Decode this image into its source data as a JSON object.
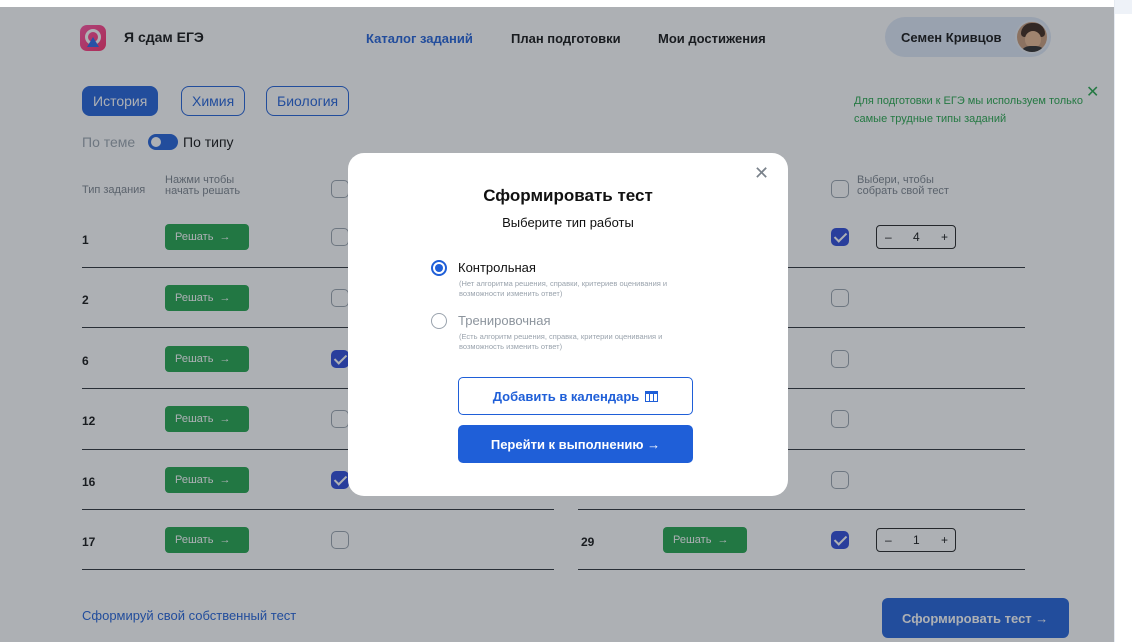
{
  "header": {
    "brand": "Я сдам ЕГЭ",
    "nav": [
      "Каталог заданий",
      "План подготовки",
      "Мои достижения"
    ],
    "user_name": "Семен Кривцов"
  },
  "subjects": [
    "История",
    "Химия",
    "Биология"
  ],
  "toggle": {
    "left": "По теме",
    "right": "По типу"
  },
  "table": {
    "col_type": "Тип задания",
    "col_solve": "Нажми чтобы начать решать",
    "col_select": "Выбери, чтобы собрать свой тест",
    "solve_label": "Решать",
    "arrow": "→",
    "left_rows": [
      {
        "num": "1",
        "checked": false
      },
      {
        "num": "2",
        "checked": false
      },
      {
        "num": "6",
        "checked": true
      },
      {
        "num": "12",
        "checked": false
      },
      {
        "num": "16",
        "checked": true
      },
      {
        "num": "17",
        "checked": false
      }
    ],
    "right_rows": [
      {
        "checked": true,
        "stepper": "4"
      },
      {
        "checked": false
      },
      {
        "checked": false
      },
      {
        "checked": false
      },
      {
        "checked": false
      },
      {
        "num": "29",
        "checked": true,
        "stepper": "1"
      }
    ],
    "stepper_minus": "–",
    "stepper_plus": "+"
  },
  "footer": {
    "own_test": "Сформируй свой собственный тест",
    "form_button": "Сформировать тест →"
  },
  "toast": {
    "text": "Для подготовки к ЕГЭ мы используем только самые трудные типы заданий",
    "close": "✕"
  },
  "modal": {
    "close": "✕",
    "title": "Сформировать тест",
    "subtitle": "Выберите тип работы",
    "option1_label": "Контрольная",
    "option1_desc": "(Нет алгоритма решения, справки, критериев оценивания и возможности изменить ответ)",
    "option2_label": "Тренировочная",
    "option2_desc": "(Есть алгоритм решения, справка, критерии оценивания и возможность изменить ответ)",
    "calendar_button": "Добавить в календарь",
    "go_button": "Перейти к выполнению →"
  },
  "colors": {
    "primary": "#1f5fd8",
    "green": "#1fa34a",
    "checkbox": "#2b47d8"
  }
}
